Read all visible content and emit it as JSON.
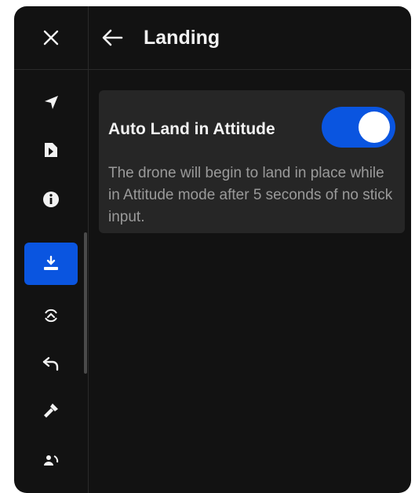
{
  "rail": {
    "items": [
      {
        "icon": "close-icon"
      },
      {
        "icon": "navigation-arrow-icon"
      },
      {
        "icon": "document-icon"
      },
      {
        "icon": "info-icon"
      },
      {
        "icon": "landing-icon",
        "active": true
      },
      {
        "icon": "auto-return-icon"
      },
      {
        "icon": "return-icon"
      },
      {
        "icon": "flashlight-icon"
      },
      {
        "icon": "user-rotate-icon"
      }
    ]
  },
  "header": {
    "title": "Landing"
  },
  "setting": {
    "label": "Auto Land in Attitude",
    "enabled": true,
    "description": "The drone will begin to land in place while in Attitude mode after 5 seconds of no stick input."
  },
  "colors": {
    "background": "#121212",
    "card": "#262626",
    "accent": "#0a55e0",
    "text": "#f2f2f2",
    "muted": "#9a9a9a"
  }
}
